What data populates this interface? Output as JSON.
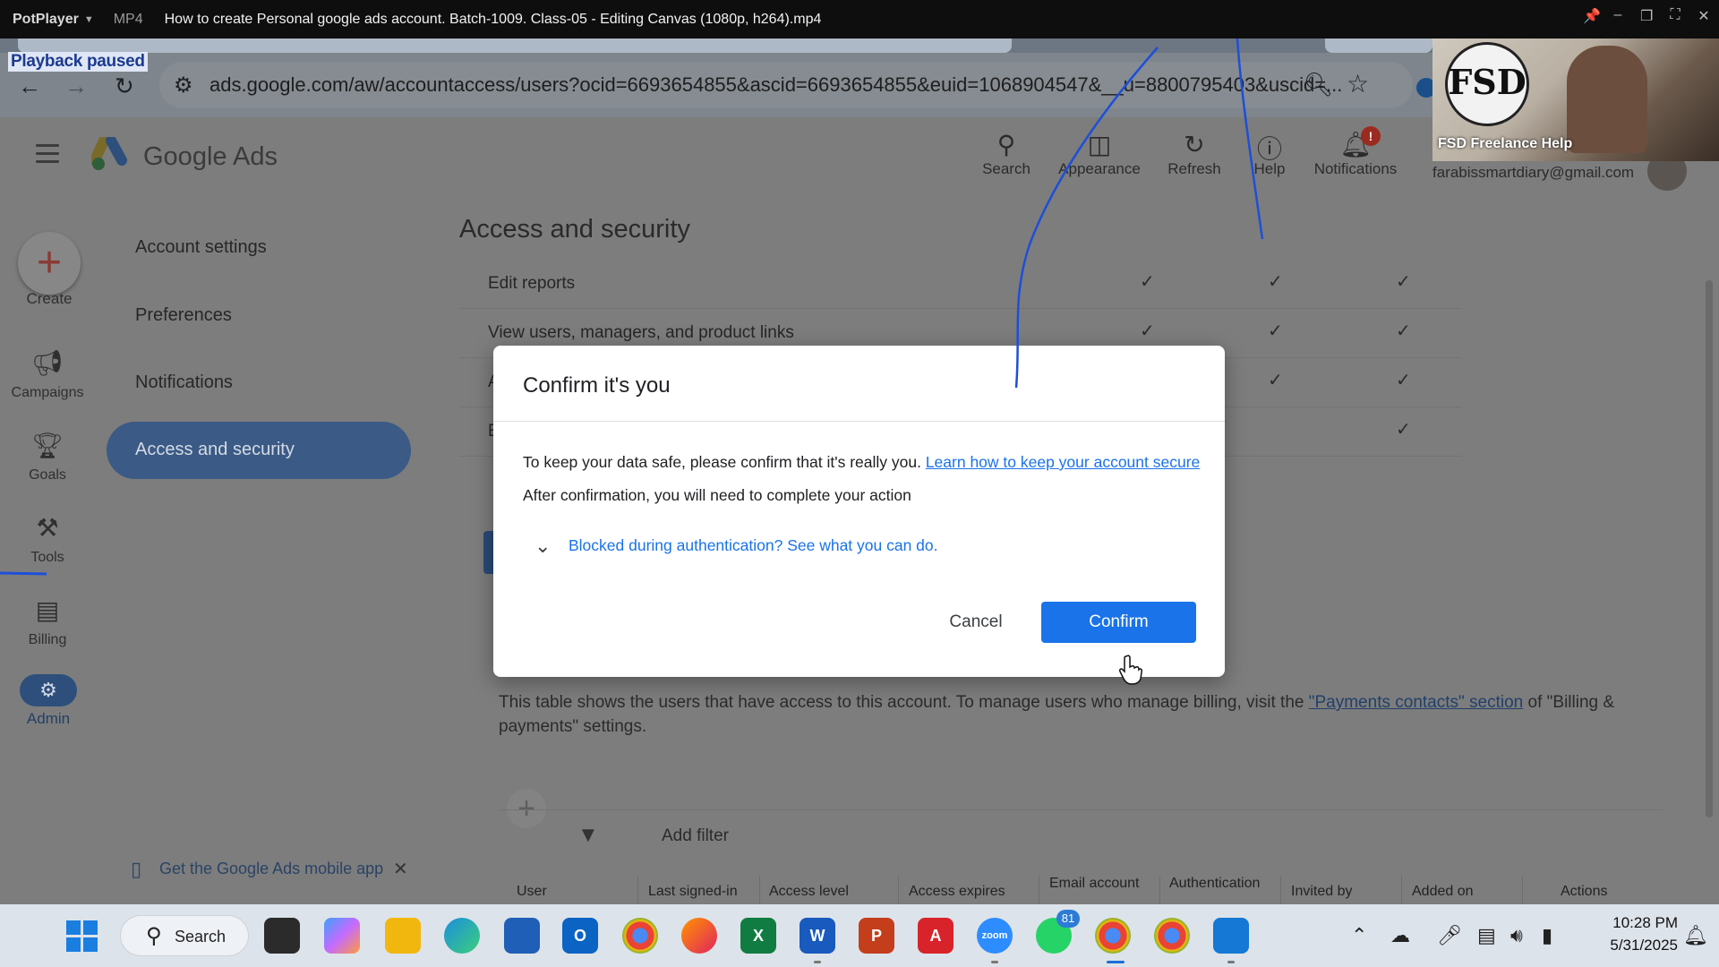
{
  "player": {
    "app_name": "PotPlayer",
    "format": "MP4",
    "title": "How to create Personal google ads account. Batch-1009. Class-05 - Editing Canvas (1080p, h264).mp4",
    "status": "Playback paused"
  },
  "browser": {
    "url": "ads.google.com/aw/accountaccess/users?ocid=6693654855&ascid=6693654855&euid=1068904547&__u=8800795403&uscid=..."
  },
  "ads_header": {
    "brand": "Google Ads",
    "actions": [
      {
        "label": "Search",
        "icon": "search-icon"
      },
      {
        "label": "Appearance",
        "icon": "appearance-icon"
      },
      {
        "label": "Refresh",
        "icon": "refresh-icon"
      },
      {
        "label": "Help",
        "icon": "help-icon"
      },
      {
        "label": "Notifications",
        "icon": "notifications-icon"
      }
    ],
    "notification_badge": "!",
    "account_email": "farabissmartdiary@gmail.com"
  },
  "left_rail": {
    "items": [
      {
        "label": "Create",
        "icon": "plus-icon"
      },
      {
        "label": "Campaigns",
        "icon": "megaphone-icon"
      },
      {
        "label": "Goals",
        "icon": "trophy-icon"
      },
      {
        "label": "Tools",
        "icon": "tools-icon"
      },
      {
        "label": "Billing",
        "icon": "credit-card-icon"
      },
      {
        "label": "Admin",
        "icon": "gear-icon"
      }
    ],
    "active": "Admin"
  },
  "settings_nav": {
    "items": [
      "Account settings",
      "Preferences",
      "Notifications",
      "Access and security"
    ],
    "active": "Access and security"
  },
  "main": {
    "page_title": "Access and security",
    "permission_rows": [
      {
        "label": "Edit reports",
        "checks": [
          true,
          true,
          true
        ]
      },
      {
        "label": "View users, managers, and product links",
        "checks": [
          true,
          true,
          true
        ]
      },
      {
        "label": "A",
        "checks": [
          false,
          true,
          true
        ]
      },
      {
        "label": "E",
        "checks": [
          false,
          false,
          true
        ]
      }
    ],
    "table_description_before": "This table shows the users that have access to this account. To manage users who manage billing, visit the ",
    "table_description_link": "\"Payments contacts\" section",
    "table_description_after": " of \"Billing & payments\" settings.",
    "add_filter": "Add filter",
    "columns": [
      "User",
      "Last signed-in",
      "Access level",
      "Access expires",
      "Email account",
      "Authentication",
      "Invited by",
      "Added on",
      "Actions"
    ]
  },
  "modal": {
    "title": "Confirm it's you",
    "body_text": "To keep your data safe, please confirm that it's really you. ",
    "learn_link": "Learn how to keep your account secure",
    "body_text2": "After confirmation, you will need to complete your action",
    "expander": "Blocked during authentication? See what you can do.",
    "cancel_label": "Cancel",
    "confirm_label": "Confirm"
  },
  "mobile_promo": {
    "text": "Get the Google Ads mobile app"
  },
  "webcam": {
    "channel": "FSD Freelance Help",
    "logo_text": "FSD"
  },
  "taskbar": {
    "search_label": "Search",
    "whatsapp_badge": "81",
    "time": "10:28 PM",
    "date": "5/31/2025"
  },
  "colors": {
    "accent_blue": "#1a73e8",
    "dim_overlay": "#7d7d7d",
    "active_nav": "#3b5a86"
  }
}
